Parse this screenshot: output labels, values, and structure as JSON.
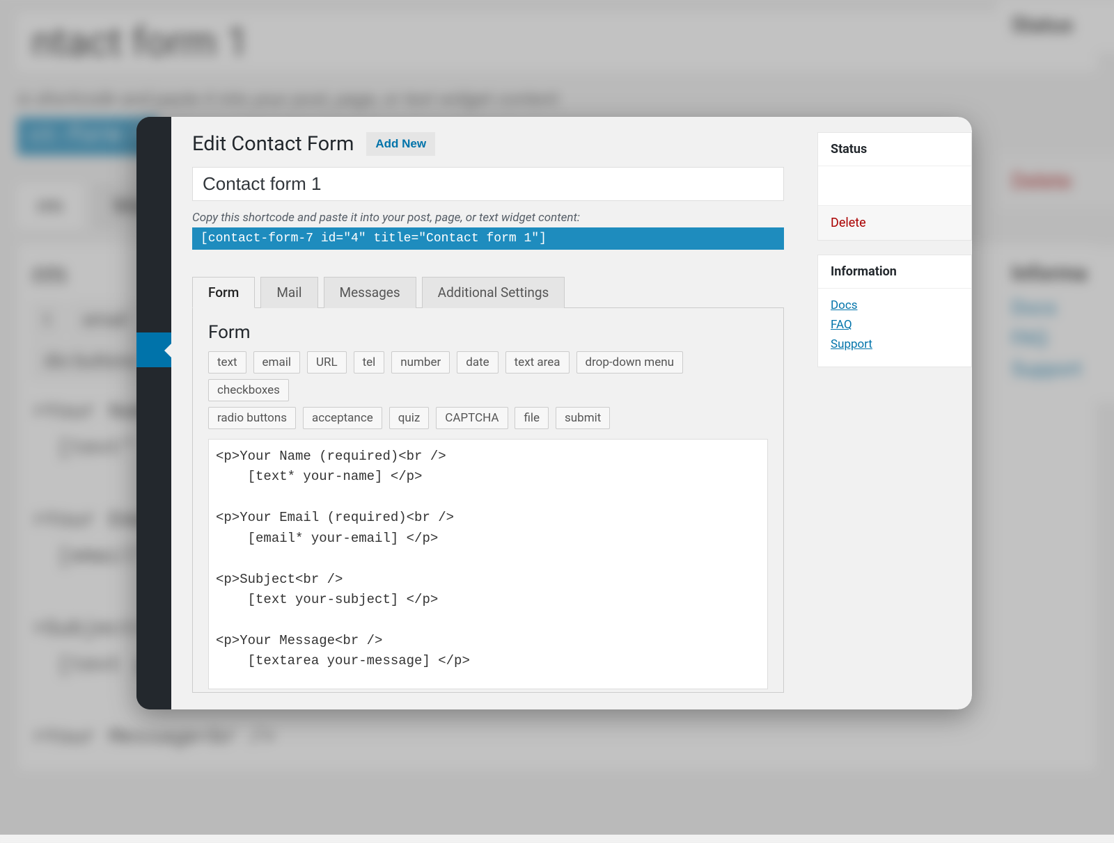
{
  "bg": {
    "title": "ntact form 1",
    "status": "Status",
    "hint": "is shortcode and paste it into your post, page, or text widget content:",
    "shortcode": "ct-form-7",
    "tabs": [
      "rm",
      "Mail"
    ],
    "delete": "Delete",
    "info_title": "Informa",
    "info_links": [
      "Docs",
      "FAQ",
      "Support"
    ],
    "panel_title": "rm",
    "tagbuttons": [
      "t",
      "email",
      "dio buttons"
    ],
    "code": ">Your Name\n  [text* y\n\n>Your Emai\n  [email*\n\n>Subject<b\n  [text your-subject] </p>\n\n>Your Message<br />"
  },
  "header": {
    "title": "Edit Contact Form",
    "add_new": "Add New"
  },
  "form_title": "Contact form 1",
  "shortcode_hint": "Copy this shortcode and paste it into your post, page, or text widget content:",
  "shortcode": "[contact-form-7 id=\"4\" title=\"Contact form 1\"]",
  "tabs": {
    "form": "Form",
    "mail": "Mail",
    "messages": "Messages",
    "additional": "Additional Settings"
  },
  "panel": {
    "title": "Form",
    "tag_buttons": [
      "text",
      "email",
      "URL",
      "tel",
      "number",
      "date",
      "text area",
      "drop-down menu",
      "checkboxes",
      "radio buttons",
      "acceptance",
      "quiz",
      "CAPTCHA",
      "file",
      "submit"
    ],
    "code": "<p>Your Name (required)<br />\n    [text* your-name] </p>\n\n<p>Your Email (required)<br />\n    [email* your-email] </p>\n\n<p>Subject<br />\n    [text your-subject] </p>\n\n<p>Your Message<br />\n    [textarea your-message] </p>\n\n<p>[submit \"Send\"]</p>"
  },
  "sidebar": {
    "status_title": "Status",
    "delete": "Delete",
    "info_title": "Information",
    "info_links": {
      "docs": "Docs",
      "faq": "FAQ",
      "support": "Support"
    }
  }
}
